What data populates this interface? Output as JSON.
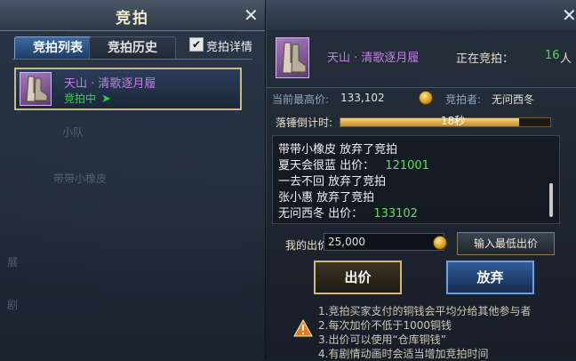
{
  "left_panel": {
    "title": "竞拍",
    "tabs": [
      {
        "label": "竞拍列表",
        "active": true
      },
      {
        "label": "竞拍历史",
        "active": false
      }
    ],
    "detail_checkbox": {
      "label": "竞拍详情",
      "checked": true,
      "mark": "✔"
    },
    "item": {
      "name": "天山 · 清歌逐月履",
      "status": "竞拍中",
      "icon": "boots-icon"
    },
    "background_text": [
      "小队",
      "带带小橡皮",
      "展",
      "剧"
    ]
  },
  "right_panel": {
    "item_name": "天山 · 清歌逐月履",
    "bidding_label": "正在竞拍：",
    "bidding_count": "16",
    "bidding_unit": "人",
    "highest_price_label": "当前最高价:",
    "highest_price_value": "133,102",
    "bidder_label": "竞拍者:",
    "bidder_value": "无问西冬",
    "countdown_label": "落锤倒计时:",
    "countdown_text": "18秒",
    "countdown_fraction": 0.85,
    "log": [
      {
        "name": "带带小橡皮",
        "action": "放弃了竞拍",
        "amount": ""
      },
      {
        "name": "夏天会很蓝",
        "action": "出价：",
        "amount": "121001"
      },
      {
        "name": "一去不回",
        "action": "放弃了竞拍",
        "amount": ""
      },
      {
        "name": "张小惠",
        "action": "放弃了竞拍",
        "amount": ""
      },
      {
        "name": "无问西冬",
        "action": "出价：",
        "amount": "133102"
      }
    ],
    "my_bid_label": "我的出价:",
    "my_bid_value": "25,000",
    "min_bid_button": "输入最低出价",
    "bid_button": "出价",
    "give_up_button": "放弃",
    "notes": [
      "1.竞拍买家支付的铜钱会平均分给其他参与者",
      "2.每次加价不低于1000铜钱",
      "3.出价可以使用“仓库铜钱”",
      "4.有剧情动画时会适当增加竞拍时间"
    ]
  },
  "close_label": "✕",
  "colors": {
    "item_name": "#c37ee6",
    "status_green": "#3ccf5a",
    "bid_amount": "#5ee05e",
    "tab_active": "#3a6aa0",
    "bid_button_border": "#d8b870",
    "give_up_button": "#305c9c"
  }
}
